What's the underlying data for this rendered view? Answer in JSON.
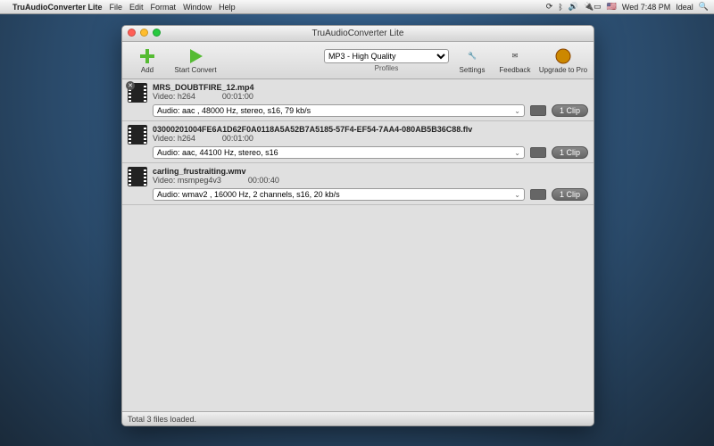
{
  "menubar": {
    "appname": "TruAudioConverter Lite",
    "items": [
      "File",
      "Edit",
      "Format",
      "Window",
      "Help"
    ],
    "status_time": "Wed 7:48 PM",
    "user": "Ideal"
  },
  "window": {
    "title": "TruAudioConverter Lite"
  },
  "toolbar": {
    "add": "Add",
    "start": "Start Convert",
    "profiles_label": "Profiles",
    "profile_selected": "MP3 - High Quality",
    "settings": "Settings",
    "feedback": "Feedback",
    "upgrade": "Upgrade to Pro"
  },
  "files": [
    {
      "filename": "MRS_DOUBTFIRE_12.mp4",
      "video": "Video: h264",
      "duration": "00:01:00",
      "audio": "Audio: aac , 48000 Hz, stereo, s16, 79 kb/s",
      "clip": "1 Clip",
      "show_close": true
    },
    {
      "filename": "03000201004FE6A1D62F0A0118A5A52B7A5185-57F4-EF54-7AA4-080AB5B36C88.flv",
      "video": "Video: h264",
      "duration": "00:01:00",
      "audio": "Audio: aac, 44100 Hz, stereo, s16",
      "clip": "1 Clip",
      "show_close": false
    },
    {
      "filename": "carling_frustraiting.wmv",
      "video": "Video: msmpeg4v3",
      "duration": "00:00:40",
      "audio": "Audio: wmav2 , 16000 Hz, 2 channels, s16, 20 kb/s",
      "clip": "1 Clip",
      "show_close": false
    }
  ],
  "status": "Total 3 files loaded."
}
